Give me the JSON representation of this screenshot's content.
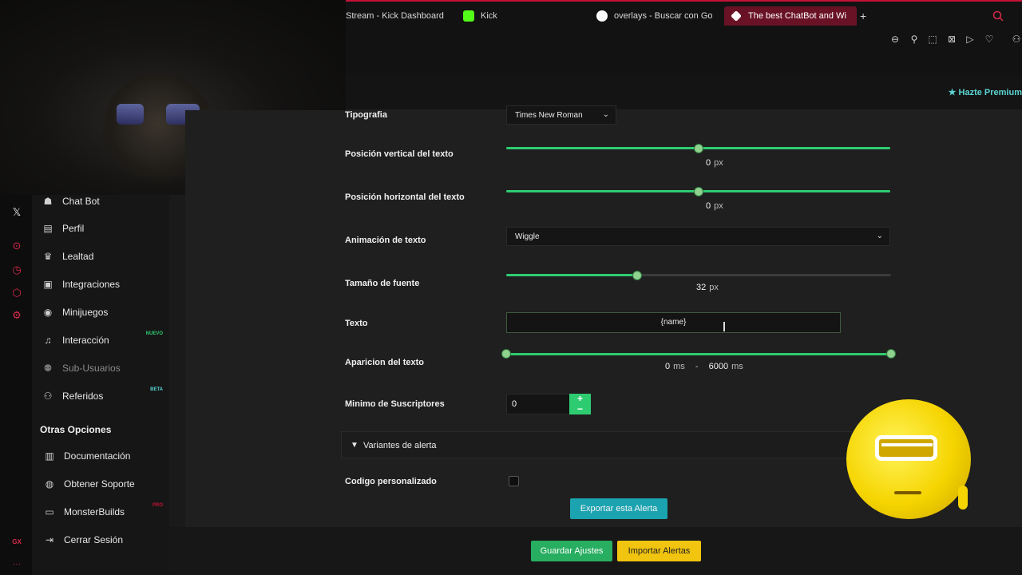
{
  "browser": {
    "tabs": [
      {
        "label": "Stream - Kick Dashboard"
      },
      {
        "label": "Kick"
      },
      {
        "label": "overlays - Buscar con Go"
      },
      {
        "label": "The best ChatBot and Wi"
      }
    ],
    "new_tab": "+",
    "toolbar_icons": [
      "zoom-out-icon",
      "pin-icon",
      "snapshot-icon",
      "shield-icon",
      "play-icon",
      "heart-icon",
      "account-icon"
    ]
  },
  "header": {
    "premium_label": "Hazte Premium"
  },
  "gx_sidebar": {
    "bottom_label": "GX",
    "more": "···"
  },
  "sidebar": {
    "items": [
      {
        "label": "Chat Bot",
        "icon": "robot-icon"
      },
      {
        "label": "Perfil",
        "icon": "id-card-icon"
      },
      {
        "label": "Lealtad",
        "icon": "trophy-icon"
      },
      {
        "label": "Integraciones",
        "icon": "plug-icon"
      },
      {
        "label": "Minijuegos",
        "icon": "gamepad-icon"
      },
      {
        "label": "Interacción",
        "icon": "music-icon",
        "badge": "NUEVO"
      },
      {
        "label": "Sub-Usuarios",
        "icon": "users-icon"
      },
      {
        "label": "Referidos",
        "icon": "people-icon",
        "badge": "BETA"
      }
    ],
    "section_title": "Otras Opciones",
    "other_items": [
      {
        "label": "Documentación",
        "icon": "book-icon"
      },
      {
        "label": "Obtener Soporte",
        "icon": "support-icon"
      },
      {
        "label": "MonsterBuilds",
        "icon": "laptop-icon",
        "badge": "PRO"
      },
      {
        "label": "Cerrar Sesión",
        "icon": "logout-icon"
      }
    ]
  },
  "form": {
    "typography": {
      "label": "Tipografia",
      "value": "Times New Roman"
    },
    "vertical_position": {
      "label": "Posición vertical del texto",
      "value": "0",
      "unit": "px",
      "fraction": 0.5
    },
    "horizontal_position": {
      "label": "Posición horizontal del texto",
      "value": "0",
      "unit": "px",
      "fraction": 0.5
    },
    "text_animation": {
      "label": "Animación de texto",
      "value": "Wiggle"
    },
    "font_size": {
      "label": "Tamaño de fuente",
      "value": "32",
      "unit": "px",
      "fraction": 0.34
    },
    "text": {
      "label": "Texto",
      "value": "{name}"
    },
    "text_appearance": {
      "label": "Aparicion del texto",
      "min": "0",
      "max": "6000",
      "unit": "ms",
      "separator": "-"
    },
    "min_subscribers": {
      "label": "Minimo de Suscriptores",
      "value": "0",
      "plus": "+",
      "minus": "−"
    },
    "variants": {
      "label": "Variantes de alerta"
    },
    "custom_code": {
      "label": "Codigo personalizado"
    },
    "export_button": "Exportar esta Alerta",
    "save_button": "Guardar Ajustes",
    "import_button": "Importar Alertas"
  },
  "colors": {
    "accent": "#2ecc71",
    "teal": "#1ba3b0",
    "yellow": "#f1c40f",
    "brand": "#c41237"
  }
}
